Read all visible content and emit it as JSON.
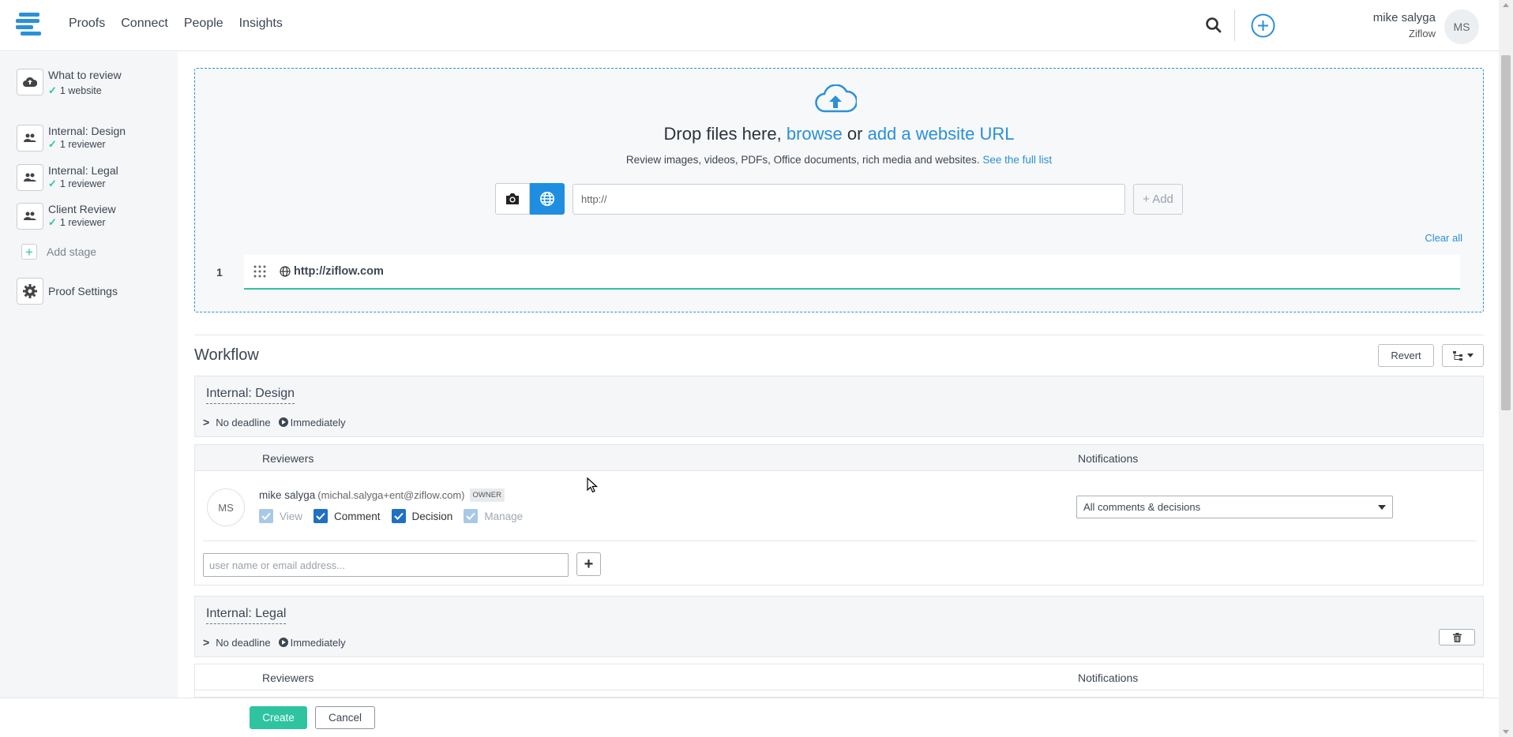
{
  "header": {
    "nav": [
      "Proofs",
      "Connect",
      "People",
      "Insights"
    ],
    "user_name": "mike salyga",
    "user_org": "Ziflow",
    "avatar_initials": "MS"
  },
  "sidebar": {
    "items": [
      {
        "title": "What to review",
        "sub": "1 website",
        "icon": "cloud-upload-icon"
      },
      {
        "title": "Internal: Design",
        "sub": "1 reviewer",
        "icon": "people-icon"
      },
      {
        "title": "Internal: Legal",
        "sub": "1 reviewer",
        "icon": "people-icon"
      },
      {
        "title": "Client Review",
        "sub": "1 reviewer",
        "icon": "people-icon"
      }
    ],
    "add_stage": "Add stage",
    "proof_settings": "Proof Settings"
  },
  "upload": {
    "title_prefix": "Drop files here,",
    "browse": "browse",
    "or": "or",
    "add_url": "add a website URL",
    "desc": "Review images, videos, PDFs, Office documents, rich media and websites.",
    "full_list": "See the full list",
    "url_placeholder": "http://",
    "add_label": "+ Add",
    "clear_all": "Clear all",
    "files": [
      {
        "num": "1",
        "url": "http://ziflow.com"
      }
    ]
  },
  "workflow": {
    "title": "Workflow",
    "revert": "Revert",
    "stages": [
      {
        "name": "Internal: Design",
        "deadline": "No deadline",
        "timing": "Immediately",
        "reviewers_label": "Reviewers",
        "notifications_label": "Notifications",
        "reviewer": {
          "initials": "MS",
          "name": "mike salyga",
          "email": "(michal.salyga+ent@ziflow.com)",
          "tag": "OWNER",
          "perms": [
            "View",
            "Comment",
            "Decision",
            "Manage"
          ],
          "notification": "All comments & decisions"
        },
        "add_placeholder": "user name or email address..."
      },
      {
        "name": "Internal: Legal",
        "deadline": "No deadline",
        "timing": "Immediately",
        "reviewers_label": "Reviewers",
        "notifications_label": "Notifications"
      }
    ]
  },
  "footer": {
    "create": "Create",
    "cancel": "Cancel"
  },
  "colors": {
    "accent": "#2a90d8",
    "success": "#2ec4a0",
    "checkbox": "#1f6fc4"
  }
}
